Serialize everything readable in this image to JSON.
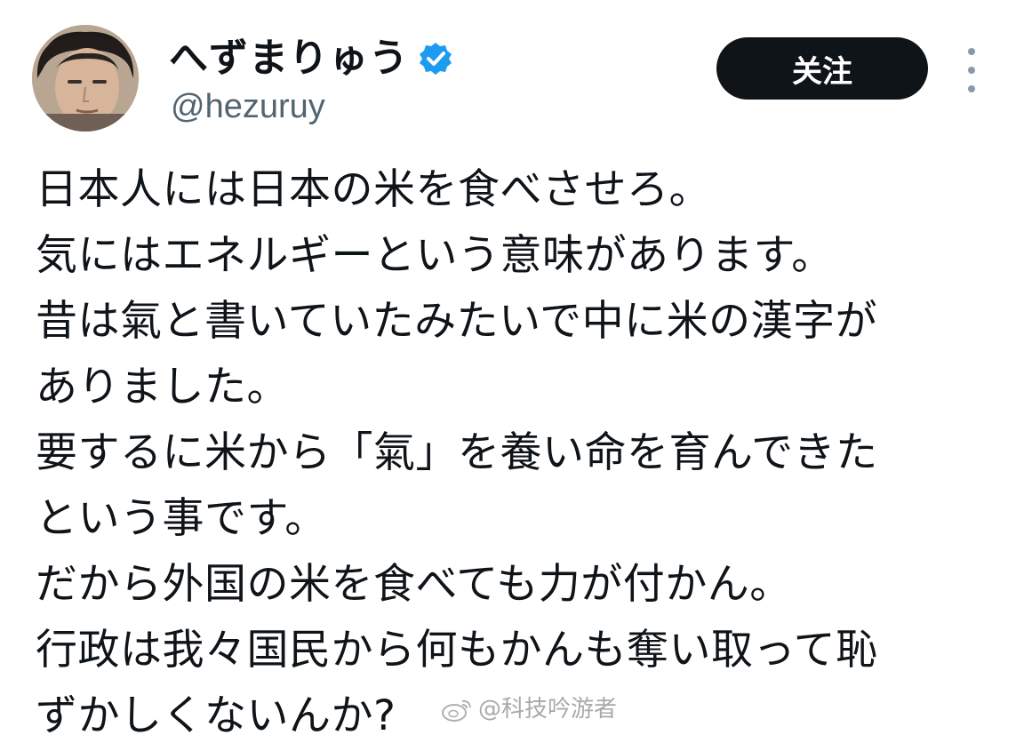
{
  "profile": {
    "display_name": "へずまりゅう",
    "handle": "@hezuruy",
    "verified_icon": "verified-badge-icon",
    "avatar_icon": "avatar-photo"
  },
  "actions": {
    "follow_label": "关注",
    "more_icon": "more-vertical-icon"
  },
  "tweet": {
    "lines": [
      "日本人には日本の米を食べさせろ。",
      "気にはエネルギーという意味があります。",
      "昔は氣と書いていたみたいで中に米の漢字が",
      "ありました。",
      "要するに米から「氣」を養い命を育んできた",
      "という事です。",
      "だから外国の米を食べても力が付かん。",
      "行政は我々国民から何もかんも奪い取って恥",
      "ずかしくないんか?"
    ]
  },
  "watermark": {
    "text": "@科技吟游者",
    "icon": "weibo-logo-icon"
  },
  "colors": {
    "text": "#0f1419",
    "secondary": "#536471",
    "button_bg": "#0f1419",
    "verified": "#1d9bf0"
  }
}
